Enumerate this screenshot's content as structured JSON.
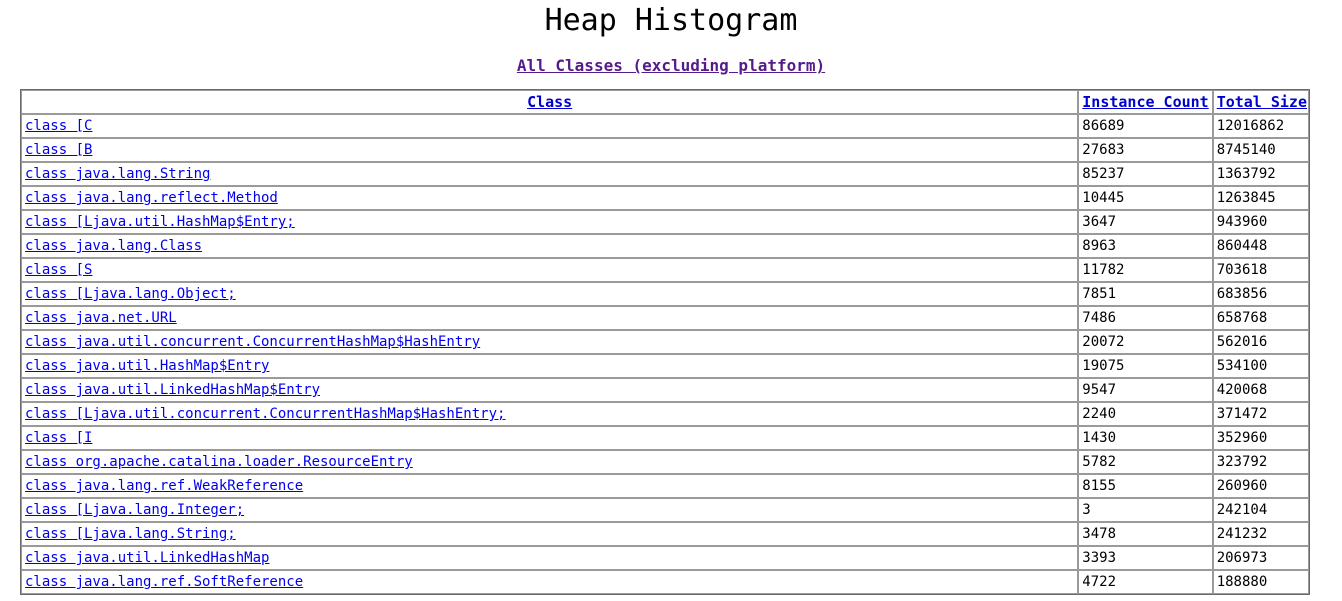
{
  "page": {
    "title": "Heap Histogram",
    "subtitle_link": "All Classes (excluding platform)"
  },
  "table": {
    "columns": [
      {
        "key": "class",
        "label": "Class"
      },
      {
        "key": "count",
        "label": "Instance Count"
      },
      {
        "key": "size",
        "label": "Total Size"
      }
    ],
    "rows": [
      {
        "class": "class [C",
        "count": "86689",
        "size": "12016862"
      },
      {
        "class": "class [B",
        "count": "27683",
        "size": "8745140"
      },
      {
        "class": "class java.lang.String",
        "count": "85237",
        "size": "1363792"
      },
      {
        "class": "class java.lang.reflect.Method",
        "count": "10445",
        "size": "1263845"
      },
      {
        "class": "class [Ljava.util.HashMap$Entry;",
        "count": "3647",
        "size": "943960"
      },
      {
        "class": "class java.lang.Class",
        "count": "8963",
        "size": "860448"
      },
      {
        "class": "class [S",
        "count": "11782",
        "size": "703618"
      },
      {
        "class": "class [Ljava.lang.Object;",
        "count": "7851",
        "size": "683856"
      },
      {
        "class": "class java.net.URL",
        "count": "7486",
        "size": "658768"
      },
      {
        "class": "class java.util.concurrent.ConcurrentHashMap$HashEntry",
        "count": "20072",
        "size": "562016"
      },
      {
        "class": "class java.util.HashMap$Entry",
        "count": "19075",
        "size": "534100"
      },
      {
        "class": "class java.util.LinkedHashMap$Entry",
        "count": "9547",
        "size": "420068"
      },
      {
        "class": "class [Ljava.util.concurrent.ConcurrentHashMap$HashEntry;",
        "count": "2240",
        "size": "371472"
      },
      {
        "class": "class [I",
        "count": "1430",
        "size": "352960"
      },
      {
        "class": "class org.apache.catalina.loader.ResourceEntry",
        "count": "5782",
        "size": "323792"
      },
      {
        "class": "class java.lang.ref.WeakReference",
        "count": "8155",
        "size": "260960"
      },
      {
        "class": "class [Ljava.lang.Integer;",
        "count": "3",
        "size": "242104"
      },
      {
        "class": "class [Ljava.lang.String;",
        "count": "3478",
        "size": "241232"
      },
      {
        "class": "class java.util.LinkedHashMap",
        "count": "3393",
        "size": "206973"
      },
      {
        "class": "class java.lang.ref.SoftReference",
        "count": "4722",
        "size": "188880"
      }
    ]
  },
  "colors": {
    "link": "#0000ee",
    "visited_link": "#551a8b",
    "header_link": "#0000cc",
    "text": "#000000",
    "background": "#ffffff"
  }
}
